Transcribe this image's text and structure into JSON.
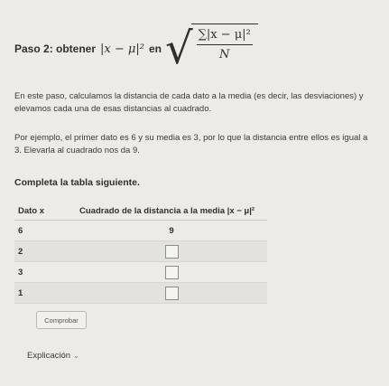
{
  "step": {
    "title": "Paso 2: obtener",
    "expr_abs_sq": "|x − μ|²",
    "connector": "en",
    "formula_num": "∑|x − μ|²",
    "formula_den": "N"
  },
  "paragraphs": [
    "En este paso, calculamos la distancia de cada dato a la media (es decir, las desviaciones) y elevamos cada una de esas distancias al cuadrado.",
    "Por ejemplo, el primer dato es 6 y su media es 3, por lo que la distancia entre ellos es igual a 3. Elevarla al cuadrado nos da 9."
  ],
  "prompt": "Completa la tabla siguiente.",
  "table": {
    "headers": [
      "Dato x",
      "Cuadrado de la distancia a la media |x − μ|²"
    ],
    "rows": [
      {
        "dato": "6",
        "cuadrado": "9"
      },
      {
        "dato": "2",
        "cuadrado": ""
      },
      {
        "dato": "3",
        "cuadrado": ""
      },
      {
        "dato": "1",
        "cuadrado": ""
      }
    ]
  },
  "check_button": "Comprobar",
  "explanation_link": "Explicación"
}
